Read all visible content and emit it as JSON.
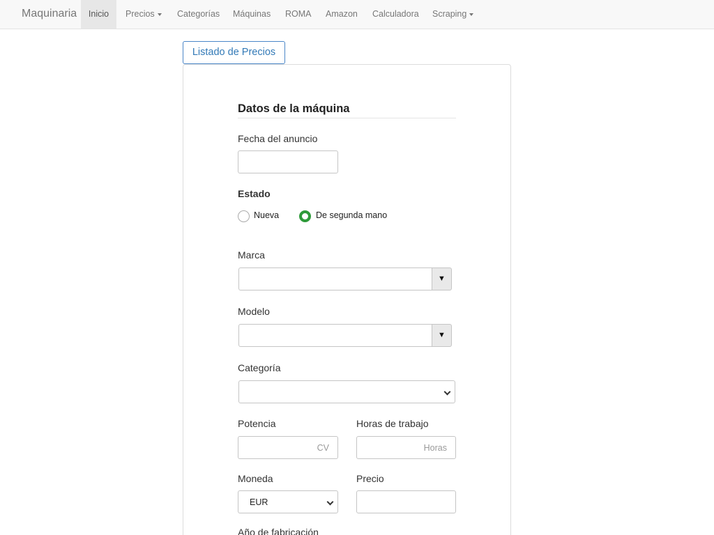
{
  "navbar": {
    "brand": "Maquinaria",
    "items": [
      {
        "label": "Inicio",
        "active": true
      },
      {
        "label": "Precios",
        "dropdown": true
      },
      {
        "label": "Categorías"
      },
      {
        "label": "Máquinas"
      },
      {
        "label": "ROMA"
      },
      {
        "label": "Amazon"
      },
      {
        "label": "Calculadora"
      },
      {
        "label": "Scraping",
        "dropdown": true
      }
    ]
  },
  "listado_button": "Listado de Precios",
  "form": {
    "section_title": "Datos de la máquina",
    "fecha": {
      "label": "Fecha del anuncio",
      "value": ""
    },
    "estado": {
      "label": "Estado",
      "options": [
        {
          "label": "Nueva",
          "checked": false
        },
        {
          "label": "De segunda mano",
          "checked": true
        }
      ]
    },
    "marca": {
      "label": "Marca",
      "value": "",
      "arrow": "▼"
    },
    "modelo": {
      "label": "Modelo",
      "value": "",
      "arrow": "▼"
    },
    "categoria": {
      "label": "Categoría",
      "value": ""
    },
    "potencia": {
      "label": "Potencia",
      "value": "",
      "suffix": "CV"
    },
    "horas": {
      "label": "Horas de trabajo",
      "value": "",
      "suffix": "Horas"
    },
    "moneda": {
      "label": "Moneda",
      "value": "EUR"
    },
    "precio": {
      "label": "Precio",
      "value": ""
    },
    "anio": {
      "label": "Año de fabricación"
    }
  },
  "colors": {
    "accent": "#337ab7",
    "radio_checked": "#2e9a3a"
  }
}
